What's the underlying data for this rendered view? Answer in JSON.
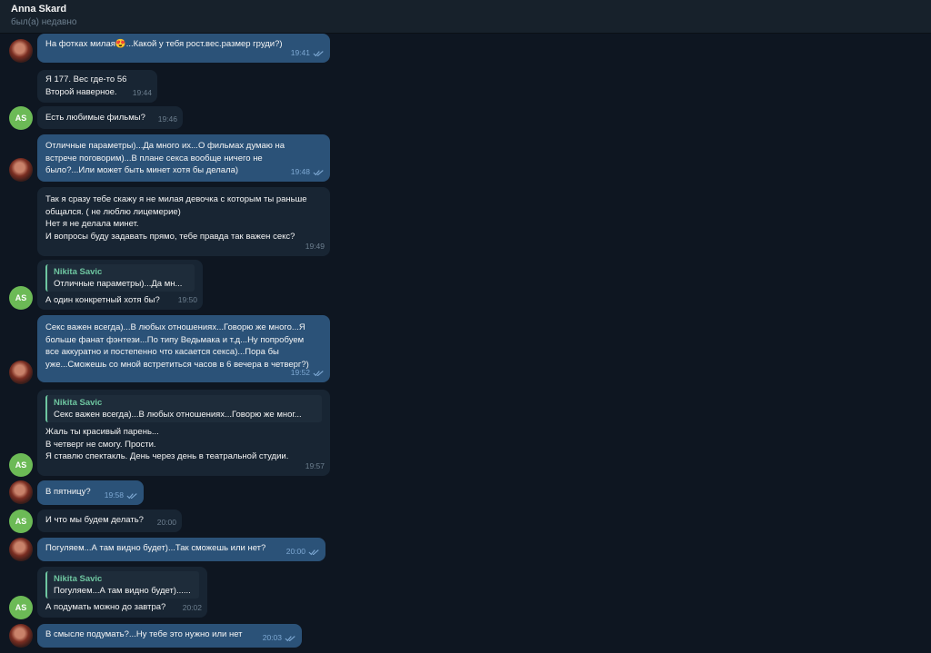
{
  "header": {
    "name": "Anna Skard",
    "status": "был(а) недавно"
  },
  "contact_initials": "AS",
  "messages": [
    {
      "dir": "out",
      "text": "На фотках милая😍...Какой у тебя рост.вес.размер груди?)",
      "time": "19:41",
      "read": true
    },
    {
      "dir": "in",
      "text": "Я 177. Вес где-то  56\nВторой наверное.",
      "time": "19:44"
    },
    {
      "dir": "in",
      "text": "Есть любимые фильмы?",
      "time": "19:46"
    },
    {
      "dir": "out",
      "text": "Отличные параметры)...Да много их...О фильмах думаю на\nвстрече поговорим)...В плане секса вообще ничего не\nбыло?...Или может быть минет хотя бы делала)",
      "time": "19:48",
      "read": true
    },
    {
      "dir": "in",
      "text": "Так я сразу тебе скажу я не милая девочка с которым ты раньше\nобщался. ( не люблю лицемерие)\nНет я не делала минет.\nИ вопросы буду задавать прямо, тебе правда так важен секс?",
      "time": "19:49"
    },
    {
      "dir": "in",
      "reply": {
        "name": "Nikita Savic",
        "text": "Отличные параметры)...Да мн..."
      },
      "text": "А один конкретный хотя бы?",
      "time": "19:50"
    },
    {
      "dir": "out",
      "text": "Секс важен всегда)...В любых отношениях...Говорю же много...Я\nбольше фанат фэнтези...По типу Ведьмака и т.д...Ну попробуем\nвсе аккуратно и постепенно что касается секса)...Пора бы\nуже...Сможешь со мной встретиться часов в 6 вечера в четверг?)",
      "time": "19:52",
      "read": true
    },
    {
      "dir": "in",
      "reply": {
        "name": "Nikita Savic",
        "text": "Секс важен всегда)...В любых отношениях...Говорю же мног..."
      },
      "text": "Жаль ты красивый парень...\nВ четверг не смогу. Прости.\n Я ставлю спектакль. День через день в театральной студии.",
      "time": "19:57"
    },
    {
      "dir": "out",
      "text": "В пятницу?",
      "time": "19:58",
      "read": true
    },
    {
      "dir": "in",
      "text": "И что мы будем делать?",
      "time": "20:00"
    },
    {
      "dir": "out",
      "text": "Погуляем...А там видно будет)...Так сможешь или нет?",
      "time": "20:00",
      "read": true
    },
    {
      "dir": "in",
      "reply": {
        "name": "Nikita Savic",
        "text": "Погуляем...А там видно будет)......"
      },
      "text": "А подумать можно до завтра?",
      "time": "20:02"
    },
    {
      "dir": "out",
      "text": "В смысле подумать?...Ну тебе это нужно или нет",
      "time": "20:03",
      "read": true
    }
  ],
  "colors": {
    "background": "#0e1621",
    "outgoing_bubble": "#2b5278",
    "incoming_bubble": "#182533",
    "avatar_initials_bg": "#6cba56",
    "reply_accent": "#6ec6a0"
  }
}
